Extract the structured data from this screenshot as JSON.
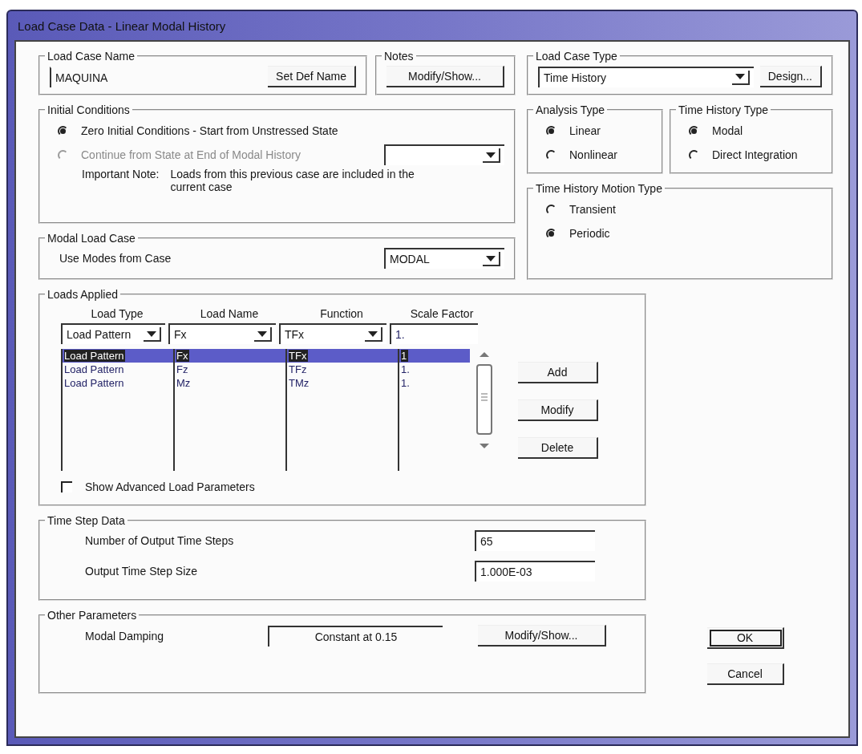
{
  "window": {
    "title": "Load Case Data - Linear Modal History"
  },
  "load_case_name": {
    "title": "Load Case Name",
    "value": "MAQUINA",
    "button": "Set Def Name"
  },
  "notes": {
    "title": "Notes",
    "button": "Modify/Show..."
  },
  "load_case_type": {
    "title": "Load Case Type",
    "value": "Time History",
    "button": "Design..."
  },
  "initial_conditions": {
    "title": "Initial Conditions",
    "options": [
      {
        "label": "Zero Initial Conditions - Start from Unstressed State",
        "selected": true,
        "disabled": false
      },
      {
        "label": "Continue from State at End of Modal History",
        "selected": false,
        "disabled": true
      }
    ],
    "note_label": "Important Note:",
    "note": "Loads from this previous case are included in the current case"
  },
  "modal_load_case": {
    "title": "Modal Load Case",
    "label": "Use Modes from Case",
    "value": "MODAL"
  },
  "analysis_type": {
    "title": "Analysis Type",
    "options": [
      {
        "label": "Linear",
        "selected": true
      },
      {
        "label": "Nonlinear",
        "selected": false
      }
    ]
  },
  "time_history_type": {
    "title": "Time History Type",
    "options": [
      {
        "label": "Modal",
        "selected": true
      },
      {
        "label": "Direct Integration",
        "selected": false
      }
    ]
  },
  "motion_type": {
    "title": "Time History Motion Type",
    "options": [
      {
        "label": "Transient",
        "selected": false
      },
      {
        "label": "Periodic",
        "selected": true
      }
    ]
  },
  "loads_applied": {
    "title": "Loads Applied",
    "columns": [
      "Load Type",
      "Load Name",
      "Function",
      "Scale Factor"
    ],
    "editor": [
      "Load Pattern",
      "Fx",
      "TFx",
      "1."
    ],
    "rows": [
      {
        "cells": [
          "Load Pattern",
          "Fx",
          "TFx",
          "1"
        ],
        "selected": true
      },
      {
        "cells": [
          "Load Pattern",
          "Fz",
          "TFz",
          "1."
        ],
        "selected": false
      },
      {
        "cells": [
          "Load Pattern",
          "Mz",
          "TMz",
          "1."
        ],
        "selected": false
      }
    ],
    "buttons": [
      "Add",
      "Modify",
      "Delete"
    ],
    "advanced": {
      "label": "Show Advanced Load Parameters",
      "checked": false
    }
  },
  "time_step_data": {
    "title": "Time Step Data",
    "fields": [
      {
        "label": "Number of Output Time Steps",
        "value": "65"
      },
      {
        "label": "Output Time Step Size",
        "value": "1.000E-03"
      }
    ]
  },
  "other_parameters": {
    "title": "Other Parameters",
    "label": "Modal Damping",
    "value": "Constant at 0.15",
    "button": "Modify/Show..."
  },
  "buttons": [
    {
      "label": "OK",
      "default": true
    },
    {
      "label": "Cancel",
      "default": false
    }
  ]
}
